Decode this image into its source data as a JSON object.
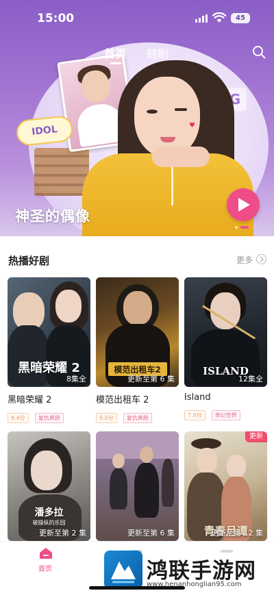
{
  "status_bar": {
    "time": "15:00",
    "battery": "45"
  },
  "header": {
    "tabs": [
      {
        "label": "首页",
        "active": true
      },
      {
        "label": "韩剧",
        "active": false
      }
    ],
    "search_icon": "search-icon"
  },
  "hero": {
    "title": "神圣的偶像",
    "badge": "IDOL",
    "poster_letter": "G",
    "play_icon": "play-icon",
    "page_indicator": {
      "count": 2,
      "active": 1
    }
  },
  "section": {
    "title": "热播好剧",
    "more": "更多"
  },
  "dramas": [
    {
      "name": "黑暗荣耀 2",
      "thumb_title": "黑暗荣耀 2",
      "episodes": "8集全",
      "score": "9.4分",
      "tag": "复仇爽剧"
    },
    {
      "name": "模范出租车 2",
      "thumb_title": "模范出租车2",
      "episodes": "更新至第 6 集",
      "score": "9.0分",
      "tag": "复仇爽剧"
    },
    {
      "name": "Island",
      "thumb_title": "ISLAND",
      "episodes": "12集全",
      "score": "7.0分",
      "tag": "奇幻世界"
    },
    {
      "name": "",
      "thumb_title": "潘多拉",
      "thumb_subtitle": "被操纵的乐园",
      "episodes": "更新至第 2 集"
    },
    {
      "name": "",
      "thumb_title": "",
      "episodes": "更新至第 6 集"
    },
    {
      "name": "",
      "thumb_title": "青春月谭",
      "episodes": "更新至第 12 集",
      "badge": "更新"
    }
  ],
  "bottom_nav": {
    "home_label": "首页"
  },
  "watermark": {
    "text": "鸿联手游网",
    "url": "www.henanhonglian95.com"
  },
  "colors": {
    "accent": "#ef4d8a",
    "hero_top": "#8a5ec6"
  }
}
